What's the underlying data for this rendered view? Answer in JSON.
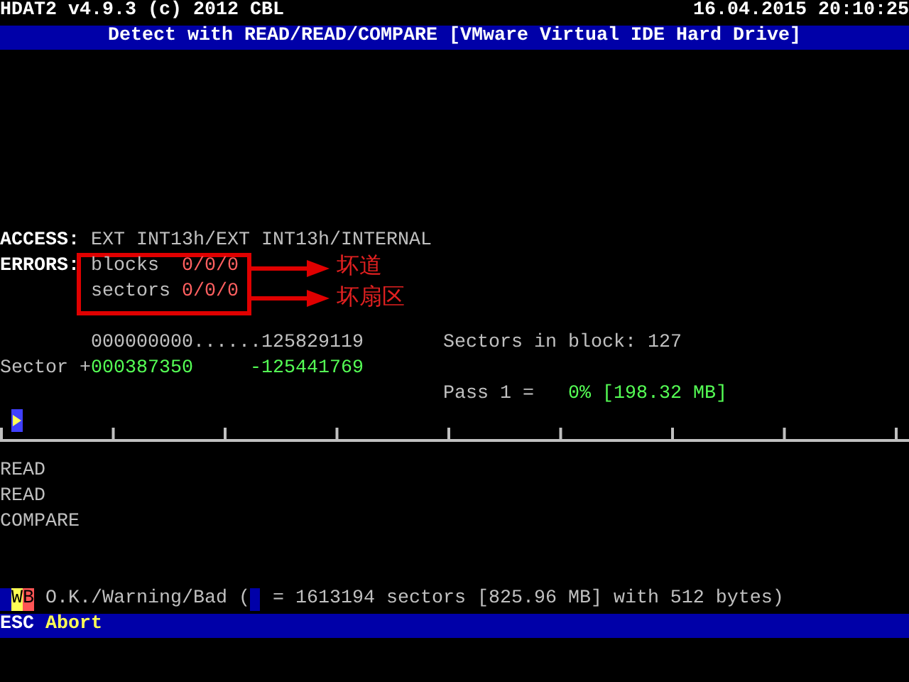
{
  "header": {
    "program": "HDAT2 v4.9.3 (c) 2012 CBL",
    "datetime": "16.04.2015 20:10:25"
  },
  "title_bar": "Detect with READ/READ/COMPARE [VMware Virtual IDE Hard Drive]",
  "access": {
    "label": "ACCESS:",
    "value": "EXT INT13h/EXT INT13h/INTERNAL"
  },
  "errors": {
    "label": "ERRORS:",
    "items": [
      {
        "name": "blocks",
        "value": "0/0/0",
        "annotation": "坏道"
      },
      {
        "name": "sectors",
        "value": "0/0/0",
        "annotation": "坏扇区"
      }
    ]
  },
  "range": {
    "text": "000000000......125829119"
  },
  "sectors_in_block": "Sectors in block: 127",
  "sector": {
    "label": "Sector",
    "sign": "+",
    "current": "000387350",
    "remaining": "-125441769"
  },
  "pass": {
    "label": "Pass 1 =",
    "value": "0% [198.32 MB]",
    "level": 0
  },
  "passes": [
    "READ",
    "READ",
    "COMPARE"
  ],
  "legend": {
    "chips": [
      {
        "color": "#0000a8"
      },
      {
        "color": "#ffff55",
        "label": "W"
      },
      {
        "color": "#ff5555",
        "label": "B"
      }
    ],
    "text": "O.K./Warning/Bad (",
    "swatch": {
      "color": "#0000a8"
    },
    "detail": "= 1613194 sectors [825.96 MB] with 512 bytes)"
  },
  "status_bar": {
    "key": "ESC",
    "action": "Abort"
  }
}
